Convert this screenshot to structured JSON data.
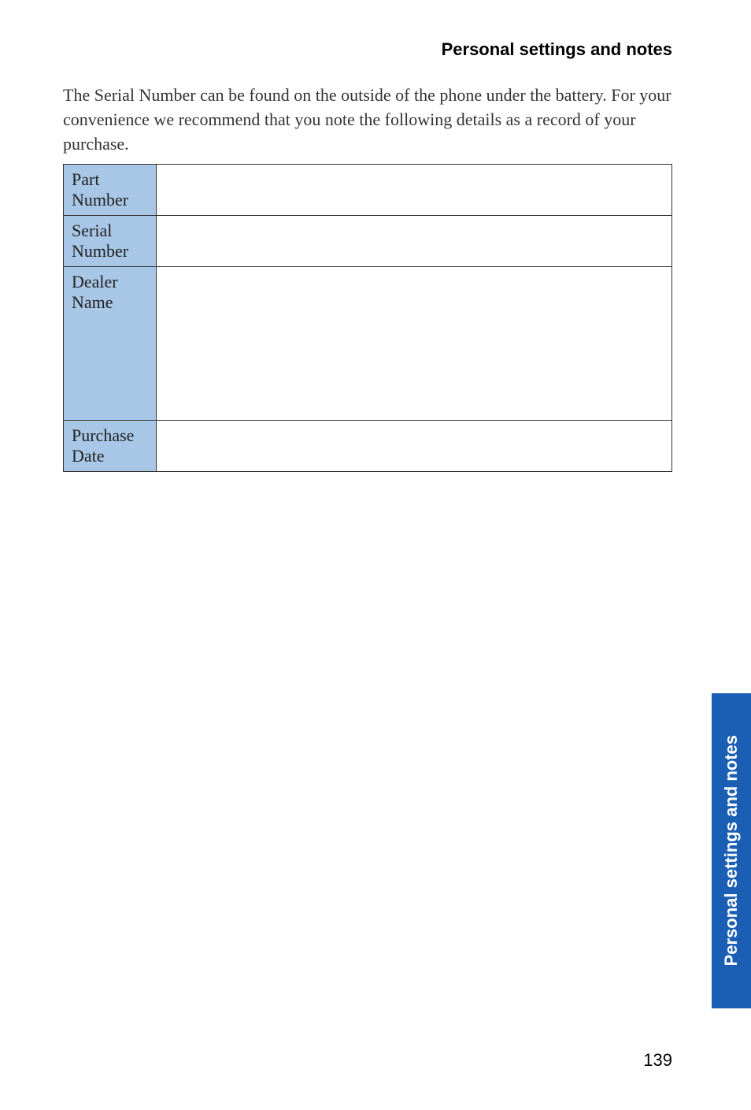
{
  "header": {
    "title": "Personal settings and notes"
  },
  "intro": "The Serial Number can be found on the outside of the phone under the battery. For your convenience we recommend that you note the following details as a record of your purchase.",
  "table": {
    "rows": [
      {
        "label": "Part Number",
        "value": "",
        "height": "normal"
      },
      {
        "label": "Serial Number",
        "value": "",
        "height": "normal"
      },
      {
        "label": "Dealer Name",
        "value": "",
        "height": "tall"
      },
      {
        "label": "Purchase Date",
        "value": "",
        "height": "normal"
      }
    ]
  },
  "sideTab": "Personal settings and notes",
  "pageNumber": "139"
}
